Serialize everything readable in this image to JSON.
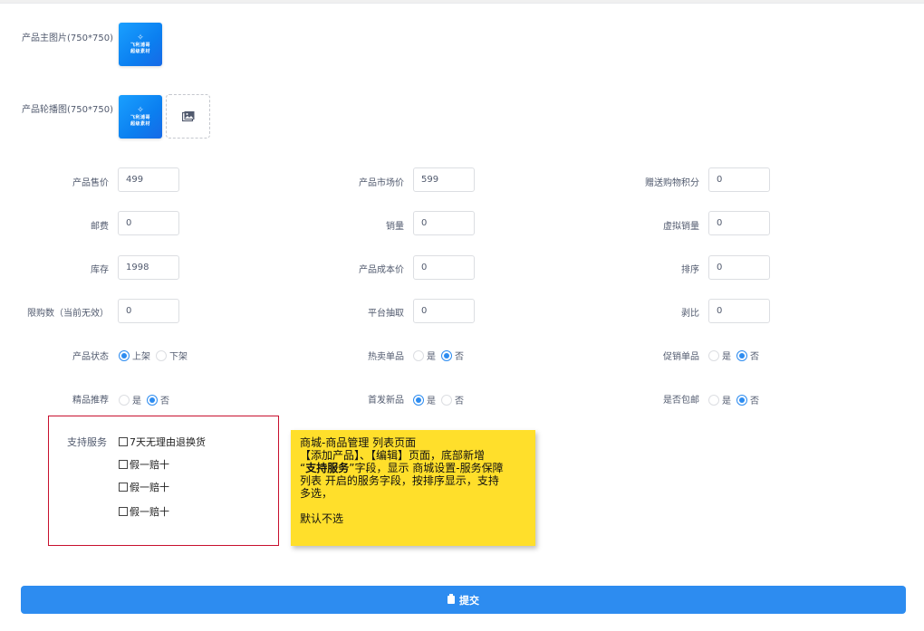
{
  "images": {
    "main_label": "产品主图片(750*750)",
    "carousel_label": "产品轮播图(750*750)",
    "thumb_text_line1": "飞利浦哥",
    "thumb_text_line2": "超级素材"
  },
  "fields": {
    "price_label": "产品售价",
    "price_value": "499",
    "market_price_label": "产品市场价",
    "market_price_value": "599",
    "points_label": "赠送购物积分",
    "points_value": "0",
    "postage_label": "邮费",
    "postage_value": "0",
    "sales_label": "销量",
    "sales_value": "0",
    "virtual_sales_label": "虚拟销量",
    "virtual_sales_value": "0",
    "stock_label": "库存",
    "stock_value": "1998",
    "cost_label": "产品成本价",
    "cost_value": "0",
    "sort_label": "排序",
    "sort_value": "0",
    "limit_label": "限购数（当前无效）",
    "limit_value": "0",
    "platform_fee_label": "平台抽取",
    "platform_fee_value": "0",
    "ratio_label": "剥比",
    "ratio_value": "0"
  },
  "radios": {
    "status_label": "产品状态",
    "status_on": "上架",
    "status_off": "下架",
    "hot_label": "热卖单品",
    "yes": "是",
    "no": "否",
    "promo_label": "促销单品",
    "featured_label": "精品推荐",
    "new_label": "首发新品",
    "free_ship_label": "是否包邮"
  },
  "services": {
    "label": "支持服务",
    "options": [
      "7天无理由退换货",
      "假一赔十",
      "假一赔十",
      "假一赔十"
    ]
  },
  "note": {
    "line1": "商城-商品管理 列表页面",
    "line2": "【添加产品】、【编辑】页面，底部新增",
    "line3_pre": "“",
    "line3_bold": "支持服务",
    "line3_post": "”字段，显示 商城设置-服务保障",
    "line4": "列表 开启的服务字段，按排序显示，支持",
    "line5": "多选，",
    "line6": "默认不选"
  },
  "submit_label": "提交",
  "colors": {
    "primary": "#2d8cf0",
    "note_bg": "#ffdf2b",
    "highlight_border": "#c8102e"
  }
}
